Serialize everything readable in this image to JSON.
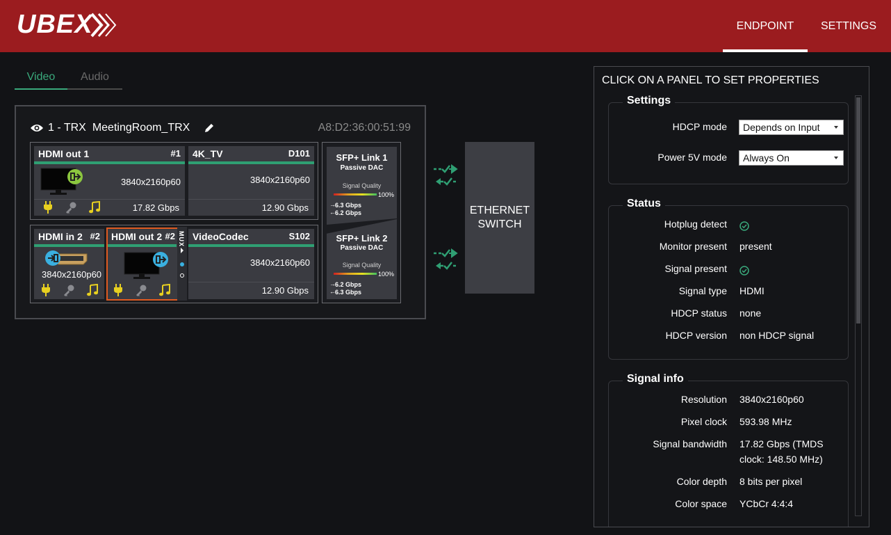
{
  "app": {
    "logo": "UBEX"
  },
  "nav": {
    "endpoint": "ENDPOINT",
    "settings": "SETTINGS"
  },
  "tabs": {
    "video": "Video",
    "audio": "Audio"
  },
  "device": {
    "index": "1 - TRX",
    "name": "MeetingRoom_TRX",
    "mac": "A8:D2:36:00:51:99"
  },
  "ports": {
    "hdmi_out_1": {
      "title": "HDMI out 1",
      "num": "#1",
      "resolution": "3840x2160p60",
      "bandwidth": "17.82 Gbps"
    },
    "tv": {
      "title": "4K_TV",
      "num": "D101",
      "resolution": "3840x2160p60",
      "bandwidth": "12.90 Gbps"
    },
    "hdmi_in_2": {
      "title": "HDMI in 2",
      "num": "#2",
      "resolution": "3840x2160p60"
    },
    "hdmi_out_2": {
      "title": "HDMI out 2",
      "num": "#2"
    },
    "mux": "MUX",
    "videocodec": {
      "title": "VideoCodec",
      "num": "S102",
      "resolution": "3840x2160p60",
      "bandwidth": "12.90 Gbps"
    }
  },
  "sfp": {
    "link1": {
      "title": "SFP+ Link 1",
      "type": "Passive DAC",
      "quality_label": "Signal Quality",
      "quality": "100%",
      "tx": "6.3 Gbps",
      "rx": "6.2 Gbps"
    },
    "link2": {
      "title": "SFP+ Link 2",
      "type": "Passive DAC",
      "quality_label": "Signal Quality",
      "quality": "100%",
      "tx": "6.2 Gbps",
      "rx": "6.3 Gbps"
    }
  },
  "switch": {
    "line1": "ETHERNET",
    "line2": "SWITCH"
  },
  "panel": {
    "title": "CLICK ON A PANEL TO SET PROPERTIES",
    "settings": {
      "title": "Settings",
      "hdcp_mode_label": "HDCP mode",
      "hdcp_mode_value": "Depends on Input",
      "power_label": "Power 5V mode",
      "power_value": "Always On"
    },
    "status": {
      "title": "Status",
      "hotplug_label": "Hotplug detect",
      "monitor_label": "Monitor present",
      "monitor_value": "present",
      "signal_label": "Signal present",
      "signal_type_label": "Signal type",
      "signal_type_value": "HDMI",
      "hdcp_status_label": "HDCP status",
      "hdcp_status_value": "none",
      "hdcp_version_label": "HDCP version",
      "hdcp_version_value": "non HDCP signal"
    },
    "signal_info": {
      "title": "Signal info",
      "resolution_label": "Resolution",
      "resolution_value": "3840x2160p60",
      "pixel_clock_label": "Pixel clock",
      "pixel_clock_value": "593.98 MHz",
      "bandwidth_label": "Signal bandwidth",
      "bandwidth_value_1": "17.82 Gbps (TMDS",
      "bandwidth_value_2": "clock: 148.50 MHz)",
      "color_depth_label": "Color depth",
      "color_depth_value": "8 bits per pixel",
      "color_space_label": "Color space",
      "color_space_value": "YCbCr 4:4:4"
    }
  },
  "colors": {
    "header": "#9b1c1f",
    "accent": "#3aaa7c",
    "output_icon": "#8cc63f",
    "input_icon": "#3ab0e0",
    "selected": "#e05a20",
    "icon_yellow": "#e8d020"
  }
}
